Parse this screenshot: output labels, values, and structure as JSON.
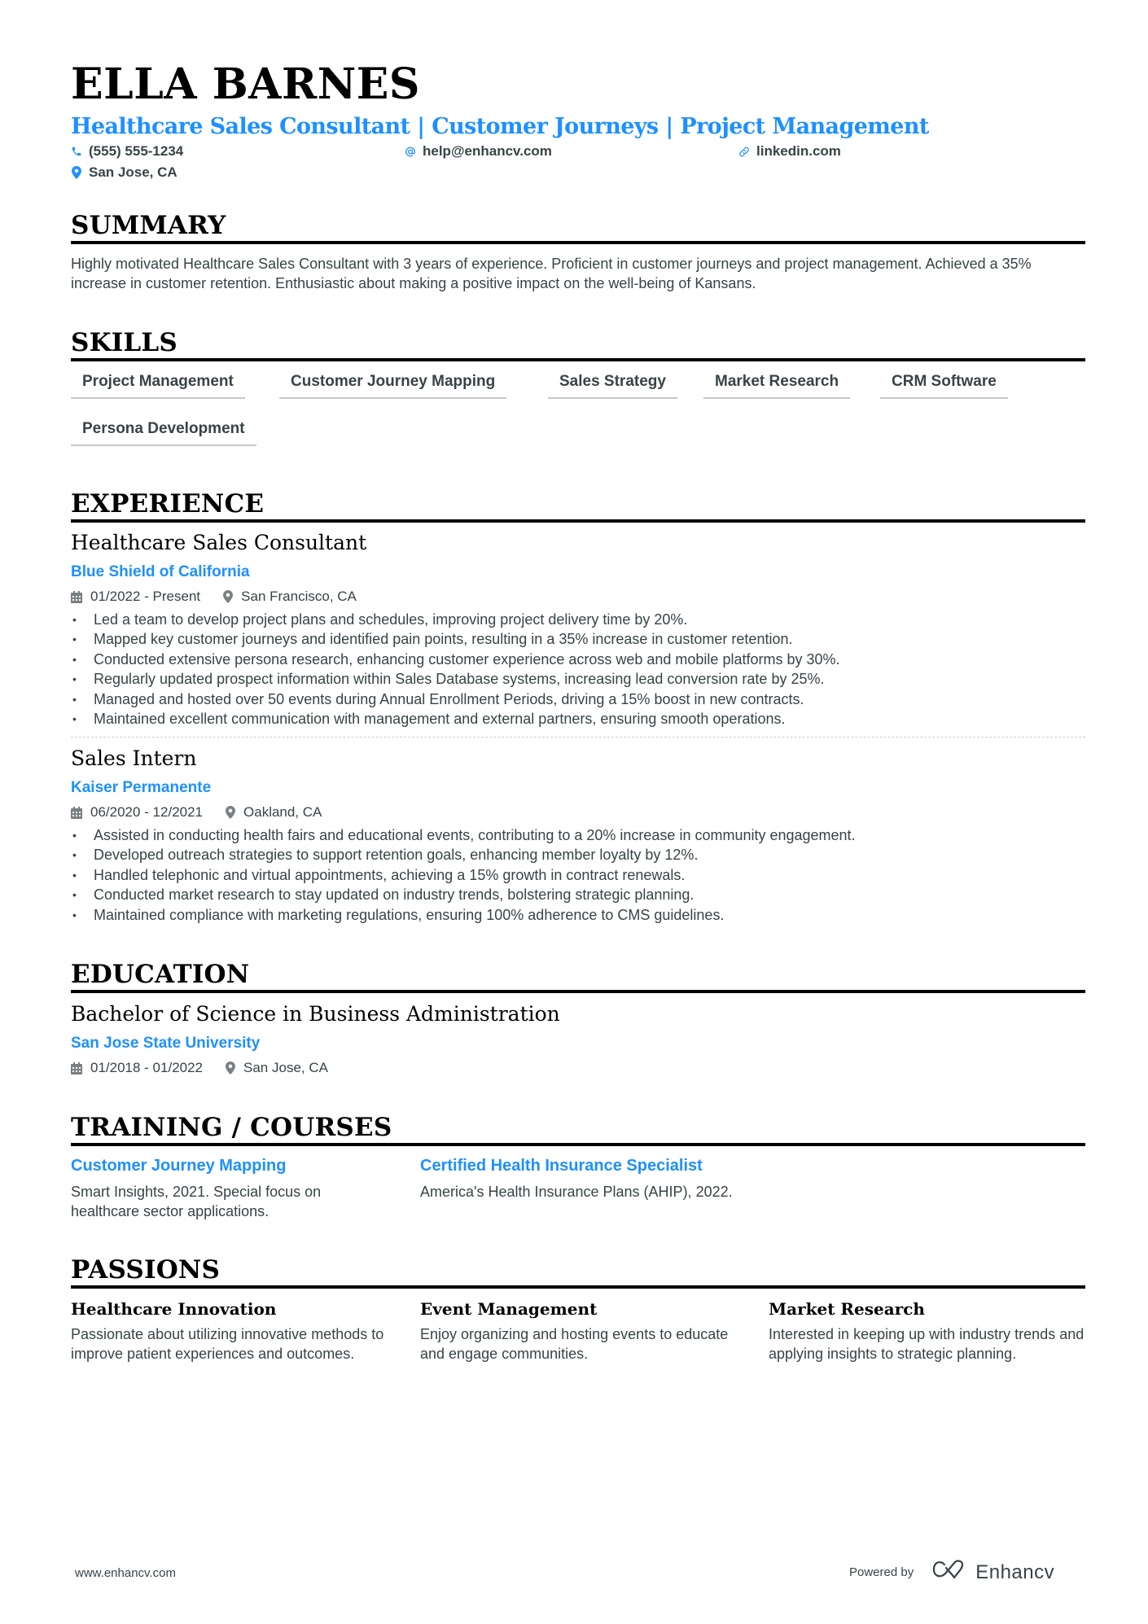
{
  "header": {
    "name": "ELLA BARNES",
    "headline": "Healthcare Sales Consultant | Customer Journeys | Project Management",
    "contacts": {
      "phone": {
        "icon": "phone-icon",
        "value": "(555) 555-1234"
      },
      "email": {
        "icon": "at-icon",
        "value": "help@enhancv.com"
      },
      "link": {
        "icon": "link-icon",
        "value": "linkedin.com"
      },
      "location": {
        "icon": "location-pin-icon",
        "value": "San Jose, CA"
      }
    }
  },
  "summary": {
    "title": "SUMMARY",
    "text": "Highly motivated Healthcare Sales Consultant with 3 years of experience. Proficient in customer journeys and project management. Achieved a 35% increase in customer retention. Enthusiastic about making a positive impact on the well-being of Kansans."
  },
  "skills": {
    "title": "SKILLS",
    "items": [
      "Project Management",
      "Customer Journey Mapping",
      "Sales Strategy",
      "Market Research",
      "CRM Software",
      "Persona Development"
    ]
  },
  "experience": {
    "title": "EXPERIENCE",
    "jobs": [
      {
        "title": "Healthcare Sales Consultant",
        "company": "Blue Shield of California",
        "dates": "01/2022 - Present",
        "location": "San Francisco, CA",
        "bullets": [
          "Led a team to develop project plans and schedules, improving project delivery time by 20%.",
          "Mapped key customer journeys and identified pain points, resulting in a 35% increase in customer retention.",
          "Conducted extensive persona research, enhancing customer experience across web and mobile platforms by 30%.",
          "Regularly updated prospect information within Sales Database systems, increasing lead conversion rate by 25%.",
          "Managed and hosted over 50 events during Annual Enrollment Periods, driving a 15% boost in new contracts.",
          "Maintained excellent communication with management and external partners, ensuring smooth operations."
        ]
      },
      {
        "title": "Sales Intern",
        "company": "Kaiser Permanente",
        "dates": "06/2020 - 12/2021",
        "location": "Oakland, CA",
        "bullets": [
          "Assisted in conducting health fairs and educational events, contributing to a 20% increase in community engagement.",
          "Developed outreach strategies to support retention goals, enhancing member loyalty by 12%.",
          "Handled telephonic and virtual appointments, achieving a 15% growth in contract renewals.",
          "Conducted market research to stay updated on industry trends, bolstering strategic planning.",
          "Maintained compliance with marketing regulations, ensuring 100% adherence to CMS guidelines."
        ]
      }
    ]
  },
  "education": {
    "title": "EDUCATION",
    "degree": "Bachelor of Science in Business Administration",
    "school": "San Jose State University",
    "dates": "01/2018 - 01/2022",
    "location": "San Jose, CA"
  },
  "training": {
    "title": "TRAINING / COURSES",
    "items": [
      {
        "title": "Customer Journey Mapping",
        "text": "Smart Insights, 2021. Special focus on healthcare sector applications."
      },
      {
        "title": "Certified Health Insurance Specialist",
        "text": "America's Health Insurance Plans (AHIP), 2022."
      }
    ]
  },
  "passions": {
    "title": "PASSIONS",
    "items": [
      {
        "title": "Healthcare Innovation",
        "text": "Passionate about utilizing innovative methods to improve patient experiences and outcomes."
      },
      {
        "title": "Event Management",
        "text": "Enjoy organizing and hosting events to educate and engage communities."
      },
      {
        "title": "Market Research",
        "text": "Interested in keeping up with industry trends and applying insights to strategic planning."
      }
    ]
  },
  "footer": {
    "website": "www.enhancv.com",
    "powered_by": "Powered by",
    "brand": "Enhancv"
  },
  "colors": {
    "accent": "#1e90ff",
    "text": "#384347",
    "heading": "#000000"
  }
}
